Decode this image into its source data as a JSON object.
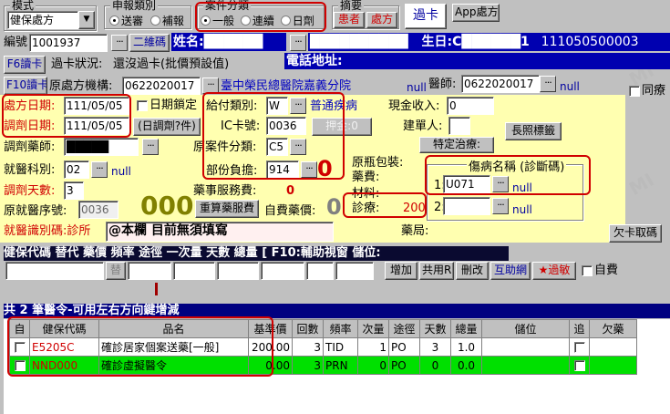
{
  "mode": {
    "caption": "模式",
    "value": "健保處方"
  },
  "review": {
    "caption": "申報類別",
    "opt1": "送審",
    "opt2": "補報"
  },
  "case_type": {
    "caption": "案件分類",
    "opt1": "一般",
    "opt2": "連續",
    "opt3": "日劑"
  },
  "summary": {
    "caption": "摘要",
    "patient_btn": "患者",
    "rx_btn": "處方"
  },
  "card_btn": "過卡",
  "app_btn": "App處方",
  "row1": {
    "id_label": "編號",
    "id_value": "1001937",
    "twocode_btn": "二維碼",
    "name_label": "姓名",
    "name_value": "██████",
    "phone_value": "██████████",
    "birth_label": "生日",
    "birth_value": "C██████1",
    "code_value": "111050500003"
  },
  "row2": {
    "f6_btn": "F6讀卡",
    "card_status_label": "過卡狀況:",
    "card_status_value": "還沒過卡(批價預設值)",
    "addr_label": "電話地址:"
  },
  "row3": {
    "f10_btn": "F10讀卡",
    "org_label": "原處方機構:",
    "org_code": "0622020017",
    "org_name": "臺中榮民總醫院嘉義分院",
    "org_null": "null",
    "doctor_label": "醫師:",
    "doctor_code": "0622020017",
    "doctor_null": "null",
    "same_label": "同療"
  },
  "dates": {
    "rx_label": "處方日期:",
    "rx_value": "111/05/05",
    "lock_label": "日期鎖定",
    "disp_label": "調劑日期:",
    "disp_value": "111/05/05",
    "disp_btn": "(日調劑?件)"
  },
  "payment": {
    "type_label": "給付類別:",
    "type_value": "W",
    "type_name": "普通疾病",
    "ic_label": "IC卡號:",
    "ic_value": "0036",
    "deposit_btn": "押金:0",
    "orig_case_label": "原案件分類:",
    "orig_case_value": "C5",
    "partial_label": "部份負擔:",
    "partial_value": "914",
    "partial_amount": "0"
  },
  "cash": {
    "income_label": "現金收入:",
    "income_value": "0",
    "builder_label": "建單人:",
    "longterm_btn": "長照標籤",
    "special_btn": "特定治療:"
  },
  "pharmacist": {
    "label": "調劑藥師:",
    "value": "█████"
  },
  "dept": {
    "label": "就醫科別:",
    "value": "02",
    "null": "null"
  },
  "days": {
    "label": "調劑天數:",
    "value": "3"
  },
  "seq": {
    "label": "原就醫序號:",
    "value": "0036",
    "big_count": "000"
  },
  "service": {
    "label": "藥事服務費:",
    "value": "0",
    "recalc_btn": "重算藥服費",
    "self_label": "自費藥價:",
    "self_value": "0"
  },
  "fees": {
    "orig_pack_label": "原瓶包裝:",
    "drug_label": "藥費:",
    "material_label": "材料:",
    "diag_label": "診療:",
    "diag_value": "200"
  },
  "diagnosis": {
    "caption": "傷病名稱 (診斷碼)",
    "r1_label": "1:",
    "r1_code": "U071",
    "r1_null": "null",
    "r2_label": "2:",
    "r2_null": "null"
  },
  "ident": {
    "label": "就醫識別碼:診所",
    "value": "@本欄 目前無須填寫",
    "pharmacy_label": "藥局:",
    "debt_btn": "欠卡取碼"
  },
  "order_header": {
    "text": "健保代碼      替代 藥價    頻率   途徑   一次量 天數 總量  [ F10:輔助視窗 儲位:"
  },
  "order_buttons": {
    "replace": "替",
    "add": "增加",
    "share": "共用R",
    "delete": "刪改",
    "interact": "互助網",
    "allergy": "★過敏",
    "selfpay": "自費"
  },
  "list_header": "共 2 筆醫令-可用左右方向鍵增減",
  "table": {
    "headers": [
      "自",
      "健保代碼",
      "品名",
      "基準價",
      "回數",
      "頻率",
      "次量",
      "途徑",
      "天數",
      "總量",
      "儲位",
      "追",
      "欠藥"
    ],
    "rows": [
      [
        "",
        "E5205C",
        "確診居家個案送藥[一般]",
        "200.00",
        "3",
        "TID",
        "1",
        "PO",
        "3",
        "1.0",
        "",
        "",
        ""
      ],
      [
        "",
        "NND000",
        "確診虛擬醫令",
        "0.00",
        "3",
        "PRN",
        "0",
        "PO",
        "0",
        "0.0",
        "",
        "",
        ""
      ]
    ]
  },
  "colors": {
    "accent_red": "#d00000",
    "name_bar": "#0000b0",
    "addr_bar": "#0000b0",
    "yellow_panel": "#ffffb0",
    "selected_row": "#00e000"
  }
}
